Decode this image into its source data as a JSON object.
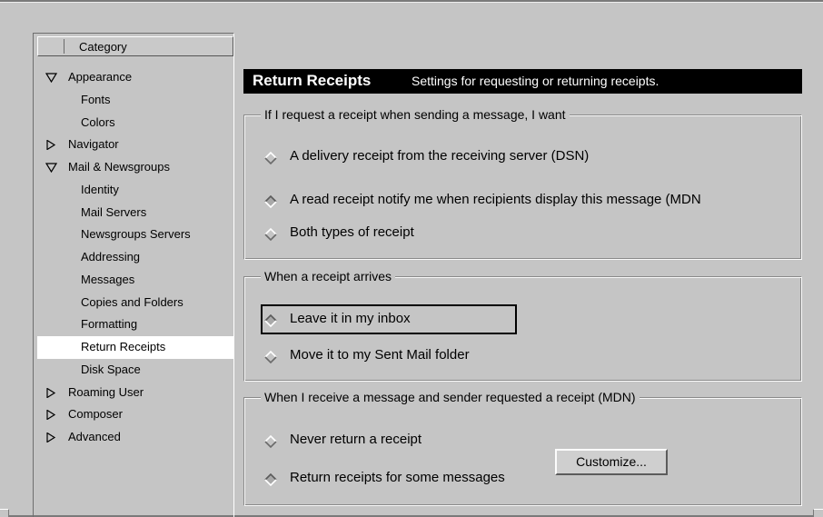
{
  "category_header": "Category",
  "tree": [
    {
      "label": "Appearance",
      "level": 0,
      "expander": "expanded"
    },
    {
      "label": "Fonts",
      "level": 1
    },
    {
      "label": "Colors",
      "level": 1
    },
    {
      "label": "Navigator",
      "level": 0,
      "expander": "collapsed"
    },
    {
      "label": "Mail & Newsgroups",
      "level": 0,
      "expander": "expanded"
    },
    {
      "label": "Identity",
      "level": 1
    },
    {
      "label": "Mail Servers",
      "level": 1
    },
    {
      "label": "Newsgroups Servers",
      "level": 1
    },
    {
      "label": "Addressing",
      "level": 1
    },
    {
      "label": "Messages",
      "level": 1
    },
    {
      "label": "Copies and Folders",
      "level": 1
    },
    {
      "label": "Formatting",
      "level": 1
    },
    {
      "label": "Return Receipts",
      "level": 1,
      "selected": true
    },
    {
      "label": "Disk Space",
      "level": 1
    },
    {
      "label": "Roaming User",
      "level": 0,
      "expander": "collapsed"
    },
    {
      "label": "Composer",
      "level": 0,
      "expander": "collapsed"
    },
    {
      "label": "Advanced",
      "level": 0,
      "expander": "collapsed"
    }
  ],
  "panel": {
    "title": "Return Receipts",
    "subtitle": "Settings for requesting or returning receipts."
  },
  "groups": {
    "request": {
      "legend": "If I request a receipt when sending a message, I want",
      "options": [
        "A delivery receipt from the receiving server (DSN)",
        "A read receipt notify me when recipients display this message (MDN",
        "Both types of receipt"
      ],
      "selected_index": 1
    },
    "arrives": {
      "legend": "When a receipt arrives",
      "options": [
        "Leave it in my inbox",
        "Move it to my Sent Mail folder"
      ],
      "selected_index": 0,
      "focused_index": 0
    },
    "receive": {
      "legend": "When I receive a message and sender requested a receipt (MDN)",
      "options": [
        "Never return a receipt",
        "Return receipts for some messages"
      ],
      "selected_index": 1,
      "customize_label": "Customize..."
    }
  },
  "colors": {
    "background": "#c5c5c5",
    "title_bar": "#000000",
    "selected_row": "#ffffff"
  }
}
